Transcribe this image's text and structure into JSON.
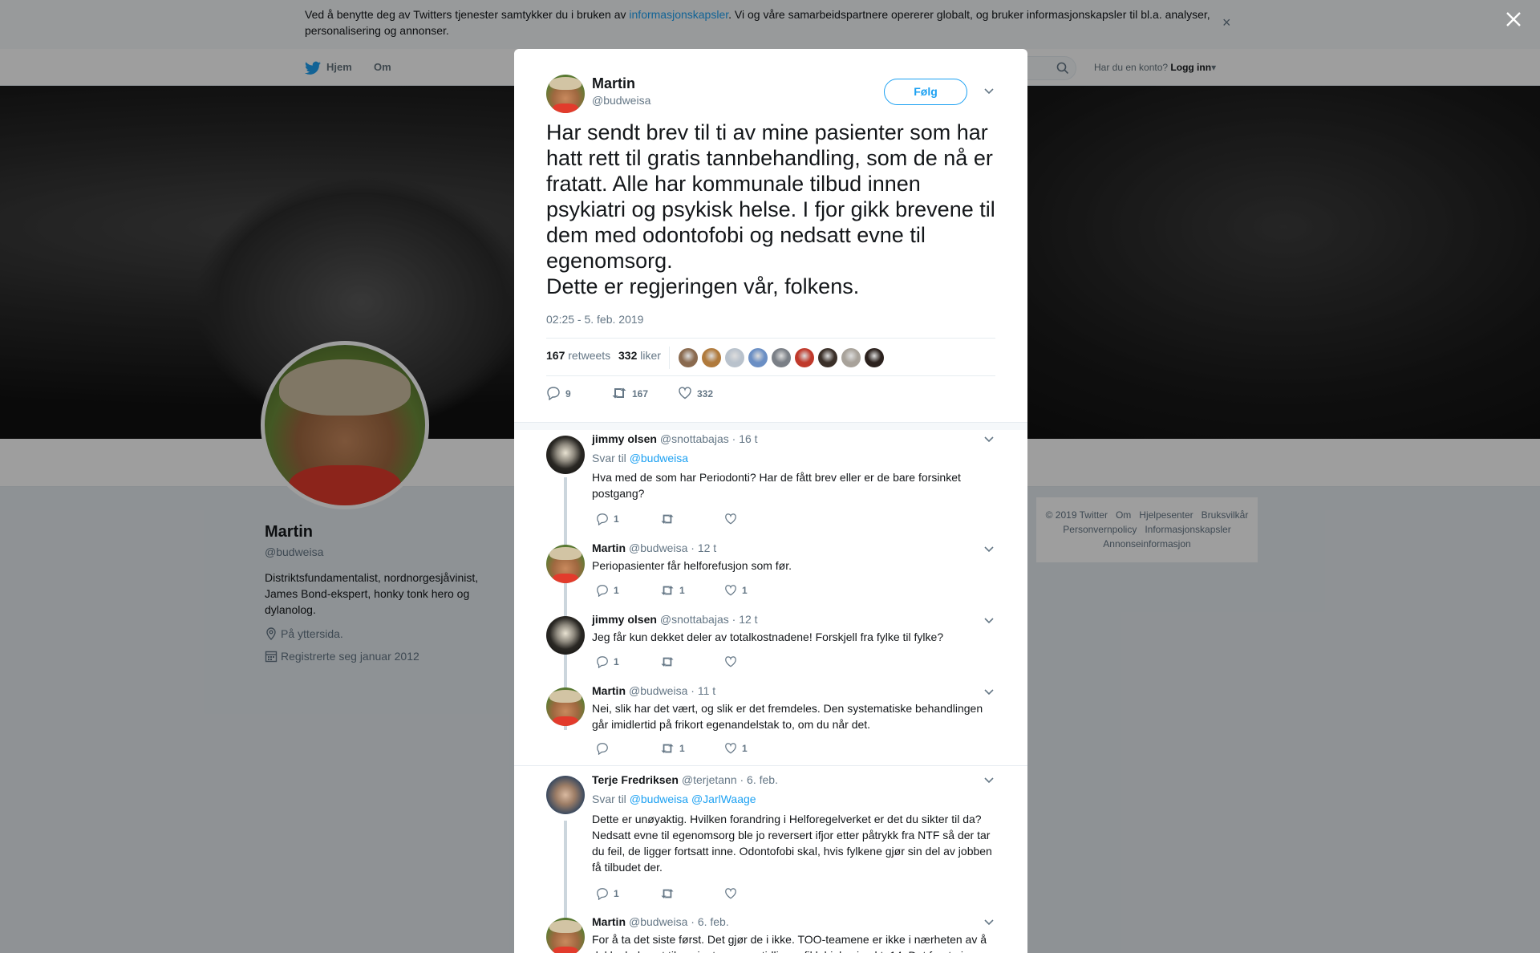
{
  "cookie_bar": {
    "text_before": "Ved å benytte deg av Twitters tjenester samtykker du i bruken av ",
    "link": "informasjonskapsler",
    "text_after": ". Vi og våre samarbeidspartnere opererer globalt, og bruker informasjonskapsler til bl.a. analyser, personalisering og annonser.",
    "close": "×"
  },
  "topnav": {
    "home": "Hjem",
    "about": "Om",
    "account_prompt": "Har du en konto?",
    "login": "Logg inn"
  },
  "profile": {
    "name": "Martin",
    "handle": "@budweisa",
    "bio": "Distriktsfundamentalist, nordnorgesjåvinist, James Bond-ekspert, honky tonk hero og dylanolog.",
    "location": "På yttersida.",
    "joined": "Registrerte seg januar 2012"
  },
  "footer": {
    "row1": [
      "© 2019 Twitter",
      "Om",
      "Hjelpesenter",
      "Bruksvilkår"
    ],
    "row2": [
      "Personvernpolicy",
      "Informasjonskapsler"
    ],
    "row3": [
      "Annonseinformasjon"
    ]
  },
  "tweet": {
    "author_name": "Martin",
    "author_handle": "@budweisa",
    "follow_label": "Følg",
    "text": "Har sendt brev til ti av mine pasienter som har hatt rett til gratis tannbehandling, som de nå er fratatt. Alle har kommunale tilbud innen psykiatri og psykisk helse. I fjor gikk brevene til dem med odontofobi og nedsatt evne til egenomsorg.\nDette er regjeringen vår, folkens.",
    "timestamp": "02:25 - 5. feb. 2019",
    "retweets_count": "167",
    "retweets_label": "retweets",
    "likes_count": "332",
    "likes_label": "liker",
    "liker_colors": [
      "#8a6a4f",
      "#b07a3c",
      "#b9c2cc",
      "#6b8fc4",
      "#7a7f86",
      "#c0392b",
      "#3b3029",
      "#a8a29a",
      "#2b211d"
    ],
    "actions": {
      "replies": "9",
      "retweets": "167",
      "likes": "332"
    }
  },
  "replies": [
    {
      "name": "jimmy olsen",
      "handle": "@snottabajas",
      "time": "· 16 t",
      "reply_prefix": "Svar til",
      "reply_to": "@budweisa",
      "text": "Hva med de som har Periodonti? Har de fått brev eller er de bare forsinket postgang?",
      "replies": "1",
      "retweets": "",
      "likes": ""
    },
    {
      "name": "Martin",
      "handle": "@budweisa",
      "time": "· 12 t",
      "text": "Periopasienter får helforefusjon som før.",
      "replies": "1",
      "retweets": "1",
      "likes": "1"
    },
    {
      "name": "jimmy olsen",
      "handle": "@snottabajas",
      "time": "· 12 t",
      "text": "Jeg får kun dekket deler av totalkostnadene! Forskjell fra fylke til fylke?",
      "replies": "1",
      "retweets": "",
      "likes": ""
    },
    {
      "name": "Martin",
      "handle": "@budweisa",
      "time": "· 11 t",
      "text": "Nei, slik har det vært, og slik er det fremdeles. Den systematiske behandlingen går imidlertid på frikort egenandelstak to, om du når det.",
      "replies": "",
      "retweets": "1",
      "likes": "1"
    },
    {
      "name": "Terje Fredriksen",
      "handle": "@terjetann",
      "time": "· 6. feb.",
      "reply_prefix": "Svar til",
      "reply_to": "@budweisa @JarlWaage",
      "text": "Dette er unøyaktig. Hvilken forandring i Helforegelverket er det du sikter til da? Nedsatt evne til egenomsorg ble jo reversert ifjor etter påtrykk fra NTF så der tar du feil, de ligger fortsatt inne. Odontofobi skal, hvis fylkene gjør sin del av jobben få tilbudet der.",
      "replies": "1",
      "retweets": "",
      "likes": ""
    },
    {
      "name": "Martin",
      "handle": "@budweisa",
      "time": "· 6. feb.",
      "text": "For å ta det siste først. Det gjør de i ikke. TOO-teamene er ikke i nærheten av å dekke behovet til pasientene som tidligere fikk hjelp via pkt. 14. Det første jeg"
    }
  ]
}
